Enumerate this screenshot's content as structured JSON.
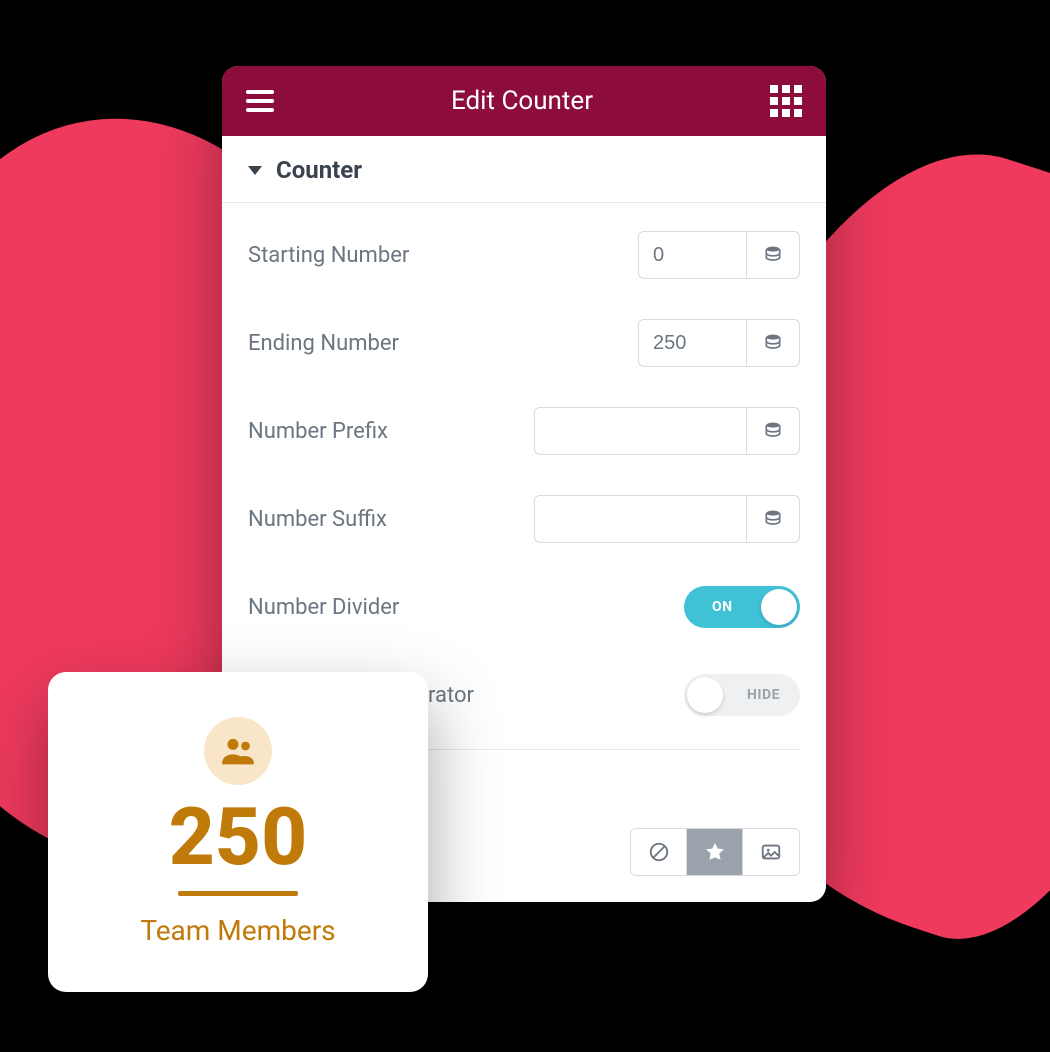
{
  "header": {
    "title": "Edit Counter"
  },
  "section": {
    "title": "Counter"
  },
  "fields": {
    "starting_number": {
      "label": "Starting Number",
      "value": "0"
    },
    "ending_number": {
      "label": "Ending Number",
      "value": "250"
    },
    "number_prefix": {
      "label": "Number Prefix",
      "value": ""
    },
    "number_suffix": {
      "label": "Number Suffix",
      "value": ""
    },
    "number_divider": {
      "label": "Number Divider",
      "state_text": "ON",
      "on": true
    },
    "separator": {
      "label": "rator",
      "state_text": "HIDE",
      "on": false
    }
  },
  "preview": {
    "value": "250",
    "label": "Team Members"
  },
  "colors": {
    "accent_header": "#8c0c3c",
    "blob": "#ef3a5d",
    "toggle_on": "#3fc1d6",
    "counter_color": "#c07a0a"
  }
}
